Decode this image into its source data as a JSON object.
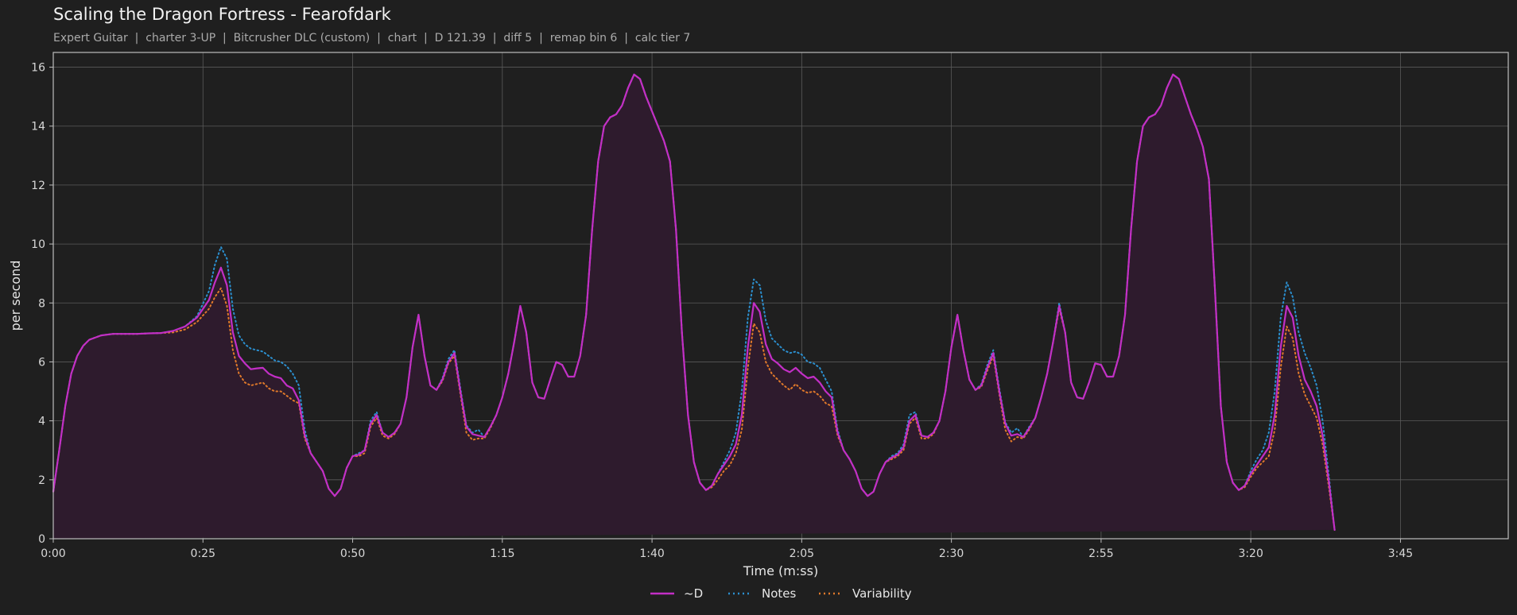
{
  "header": {
    "title": "Scaling the Dragon Fortress - Fearofdark",
    "subtitle": "Expert Guitar  |  charter 3-UP  |  Bitcrusher DLC (custom)  |  chart  |  D 121.39  |  diff 5  |  remap bin 6  |  calc tier 7"
  },
  "colors": {
    "background": "#1f1f1f",
    "grid": "#5a5a5a",
    "axes": "#bdbdbd",
    "fill": "#2e1b2d"
  },
  "chart_data": {
    "type": "line",
    "xlabel": "Time (m:ss)",
    "ylabel": "per second",
    "xlim": [
      0,
      243
    ],
    "ylim": [
      0,
      16.5
    ],
    "grid": true,
    "legend_position": "bottom-center",
    "x_ticks": [
      {
        "value": 0,
        "label": "0:00"
      },
      {
        "value": 25,
        "label": "0:25"
      },
      {
        "value": 50,
        "label": "0:50"
      },
      {
        "value": 75,
        "label": "1:15"
      },
      {
        "value": 100,
        "label": "1:40"
      },
      {
        "value": 125,
        "label": "2:05"
      },
      {
        "value": 150,
        "label": "2:30"
      },
      {
        "value": 175,
        "label": "2:55"
      },
      {
        "value": 200,
        "label": "3:20"
      },
      {
        "value": 225,
        "label": "3:45"
      }
    ],
    "y_ticks": [
      {
        "value": 0,
        "label": "0"
      },
      {
        "value": 2,
        "label": "2"
      },
      {
        "value": 4,
        "label": "4"
      },
      {
        "value": 6,
        "label": "6"
      },
      {
        "value": 8,
        "label": "8"
      },
      {
        "value": 10,
        "label": "10"
      },
      {
        "value": 12,
        "label": "12"
      },
      {
        "value": 14,
        "label": "14"
      },
      {
        "value": 16,
        "label": "16"
      }
    ],
    "x": [
      0,
      1,
      2,
      3,
      4,
      5,
      6,
      8,
      10,
      12,
      14,
      16,
      18,
      20,
      22,
      24,
      26,
      27,
      28,
      29,
      30,
      31,
      32,
      33,
      34,
      35,
      36,
      37,
      38,
      39,
      40,
      41,
      42,
      43,
      44,
      45,
      46,
      47,
      48,
      49,
      50,
      51,
      52,
      53,
      54,
      55,
      56,
      57,
      58,
      59,
      60,
      61,
      62,
      63,
      64,
      65,
      66,
      67,
      68,
      69,
      70,
      71,
      72,
      73,
      74,
      75,
      76,
      77,
      78,
      79,
      80,
      81,
      82,
      83,
      84,
      85,
      86,
      87,
      88,
      89,
      90,
      91,
      92,
      93,
      94,
      95,
      96,
      97,
      98,
      99,
      100,
      101,
      102,
      103,
      104,
      105,
      106,
      107,
      108,
      109,
      110,
      111,
      112,
      113,
      114,
      115,
      116,
      117,
      118,
      119,
      120,
      121,
      122,
      123,
      124,
      125,
      126,
      127,
      128,
      129,
      130,
      131,
      132,
      133,
      134,
      135,
      136,
      137,
      138,
      139,
      140,
      141,
      142,
      143,
      144,
      145,
      146,
      147,
      148,
      149,
      150,
      151,
      152,
      153,
      154,
      155,
      156,
      157,
      158,
      159,
      160,
      161,
      162,
      163,
      164,
      165,
      166,
      167,
      168,
      169,
      170,
      171,
      172,
      173,
      174,
      175,
      176,
      177,
      178,
      179,
      180,
      181,
      182,
      183,
      184,
      185,
      186,
      187,
      188,
      189,
      190,
      191,
      192,
      193,
      194,
      195,
      196,
      197,
      198,
      199,
      200,
      201,
      202,
      203,
      204,
      205,
      206,
      207,
      208,
      209,
      210,
      211,
      212,
      213,
      214,
      215,
      216,
      217,
      218,
      219,
      220,
      221,
      222,
      223,
      224,
      225,
      226,
      227,
      228,
      229,
      230,
      231,
      232,
      233,
      234,
      235,
      236,
      237,
      238,
      239,
      240,
      241,
      242,
      243
    ],
    "series": [
      {
        "name": "~D",
        "color": "#c22fc6",
        "style": "solid",
        "values": [
          1.6,
          3.0,
          4.5,
          5.6,
          6.2,
          6.55,
          6.75,
          6.9,
          6.95,
          6.95,
          6.95,
          6.97,
          6.98,
          7.05,
          7.2,
          7.5,
          8.1,
          8.7,
          9.2,
          8.6,
          7.0,
          6.2,
          5.95,
          5.75,
          5.78,
          5.8,
          5.6,
          5.5,
          5.45,
          5.2,
          5.1,
          4.7,
          3.5,
          2.9,
          2.6,
          2.3,
          1.7,
          1.45,
          1.7,
          2.4,
          2.8,
          2.85,
          3.0,
          3.9,
          4.2,
          3.6,
          3.45,
          3.6,
          3.9,
          4.8,
          6.5,
          7.6,
          6.2,
          5.2,
          5.05,
          5.4,
          6.0,
          6.3,
          5.0,
          3.8,
          3.55,
          3.5,
          3.45,
          3.8,
          4.2,
          4.8,
          5.6,
          6.7,
          7.9,
          7.0,
          5.3,
          4.8,
          4.75,
          5.4,
          6.0,
          5.9,
          5.5,
          5.5,
          6.2,
          7.6,
          10.5,
          12.8,
          14.0,
          14.3,
          14.4,
          14.7,
          15.3,
          15.75,
          15.6,
          15.0,
          14.5,
          14.0,
          13.5,
          12.8,
          10.5,
          7.0,
          4.2,
          2.6,
          1.9,
          1.65,
          1.8,
          2.2,
          2.5,
          2.8,
          3.2,
          4.2,
          6.5,
          8.0,
          7.7,
          6.6,
          6.1,
          5.95,
          5.75,
          5.65,
          5.8,
          5.6,
          5.45,
          5.5,
          5.3,
          5.0,
          4.8,
          3.6,
          3.0,
          2.7,
          2.3,
          1.7,
          1.45,
          1.6,
          2.2,
          2.6,
          2.75,
          2.85,
          3.1,
          4.0,
          4.2,
          3.5,
          3.45,
          3.6,
          4.0,
          5.0,
          6.5,
          7.6,
          6.4,
          5.4,
          5.05,
          5.2,
          5.8,
          6.3,
          5.0,
          3.9,
          3.5,
          3.55,
          3.45,
          3.75,
          4.1,
          4.8,
          5.6,
          6.7,
          7.9,
          7.0,
          5.3,
          4.8,
          4.75,
          5.3,
          5.95,
          5.9,
          5.5,
          5.5,
          6.2,
          7.6,
          10.5,
          12.8,
          14.0,
          14.3,
          14.4,
          14.7,
          15.3,
          15.75,
          15.6,
          15.0,
          14.4,
          13.9,
          13.3,
          12.2,
          8.5,
          4.5,
          2.6,
          1.9,
          1.65,
          1.8,
          2.2,
          2.5,
          2.8,
          3.1,
          4.2,
          6.5,
          7.9,
          7.5,
          6.2,
          5.4,
          5.0,
          4.5,
          3.5,
          2.0,
          0.3
        ]
      },
      {
        "name": "Notes",
        "color": "#2b8fcf",
        "style": "dotted",
        "values": [
          1.6,
          3.0,
          4.5,
          5.6,
          6.2,
          6.55,
          6.75,
          6.9,
          6.95,
          6.95,
          6.95,
          6.97,
          6.98,
          7.05,
          7.2,
          7.55,
          8.4,
          9.3,
          9.9,
          9.5,
          7.8,
          6.9,
          6.6,
          6.45,
          6.4,
          6.35,
          6.2,
          6.05,
          6.0,
          5.85,
          5.6,
          5.2,
          3.7,
          2.9,
          2.6,
          2.3,
          1.7,
          1.45,
          1.7,
          2.4,
          2.8,
          2.9,
          3.0,
          4.0,
          4.3,
          3.6,
          3.45,
          3.6,
          3.9,
          4.8,
          6.5,
          7.6,
          6.2,
          5.2,
          5.05,
          5.45,
          6.1,
          6.4,
          5.1,
          3.85,
          3.6,
          3.7,
          3.45,
          3.8,
          4.2,
          4.8,
          5.6,
          6.7,
          7.9,
          7.0,
          5.3,
          4.8,
          4.75,
          5.4,
          6.0,
          5.9,
          5.5,
          5.5,
          6.2,
          7.6,
          10.5,
          12.8,
          14.0,
          14.3,
          14.4,
          14.7,
          15.3,
          15.75,
          15.6,
          15.0,
          14.5,
          14.0,
          13.5,
          12.8,
          10.5,
          7.0,
          4.2,
          2.6,
          1.9,
          1.65,
          1.8,
          2.2,
          2.6,
          3.0,
          3.6,
          5.0,
          7.5,
          8.8,
          8.6,
          7.4,
          6.8,
          6.6,
          6.4,
          6.3,
          6.35,
          6.25,
          6.0,
          5.95,
          5.8,
          5.4,
          5.0,
          3.7,
          3.0,
          2.7,
          2.3,
          1.7,
          1.45,
          1.6,
          2.2,
          2.6,
          2.8,
          2.9,
          3.2,
          4.2,
          4.3,
          3.5,
          3.45,
          3.6,
          4.0,
          5.0,
          6.5,
          7.6,
          6.4,
          5.4,
          5.05,
          5.25,
          5.9,
          6.4,
          5.1,
          3.95,
          3.6,
          3.75,
          3.45,
          3.8,
          4.1,
          4.8,
          5.6,
          6.7,
          8.0,
          7.0,
          5.3,
          4.8,
          4.75,
          5.3,
          5.95,
          5.9,
          5.5,
          5.5,
          6.2,
          7.6,
          10.5,
          12.8,
          14.0,
          14.3,
          14.4,
          14.7,
          15.3,
          15.75,
          15.6,
          15.0,
          14.4,
          13.9,
          13.3,
          12.2,
          8.5,
          4.5,
          2.6,
          1.9,
          1.65,
          1.8,
          2.3,
          2.7,
          3.0,
          3.6,
          5.0,
          7.5,
          8.7,
          8.2,
          7.0,
          6.3,
          5.8,
          5.2,
          4.0,
          2.2,
          0.3
        ]
      },
      {
        "name": "Variability",
        "color": "#e0792a",
        "style": "dotted",
        "values": [
          1.6,
          3.0,
          4.5,
          5.6,
          6.2,
          6.55,
          6.75,
          6.9,
          6.95,
          6.95,
          6.95,
          6.97,
          6.98,
          7.0,
          7.1,
          7.35,
          7.8,
          8.2,
          8.5,
          7.9,
          6.4,
          5.6,
          5.3,
          5.2,
          5.25,
          5.3,
          5.1,
          5.0,
          5.0,
          4.85,
          4.7,
          4.6,
          3.4,
          2.9,
          2.6,
          2.3,
          1.7,
          1.45,
          1.7,
          2.4,
          2.8,
          2.8,
          2.9,
          3.8,
          4.1,
          3.5,
          3.4,
          3.55,
          3.9,
          4.8,
          6.5,
          7.6,
          6.2,
          5.2,
          5.05,
          5.35,
          5.95,
          6.2,
          4.9,
          3.6,
          3.35,
          3.4,
          3.4,
          3.75,
          4.2,
          4.8,
          5.6,
          6.7,
          7.9,
          7.0,
          5.3,
          4.8,
          4.75,
          5.4,
          6.0,
          5.9,
          5.5,
          5.5,
          6.2,
          7.6,
          10.5,
          12.8,
          14.0,
          14.3,
          14.4,
          14.7,
          15.3,
          15.75,
          15.6,
          15.0,
          14.5,
          14.0,
          13.5,
          12.8,
          10.5,
          7.0,
          4.2,
          2.6,
          1.9,
          1.65,
          1.75,
          2.0,
          2.3,
          2.5,
          2.9,
          3.7,
          5.8,
          7.3,
          7.0,
          6.0,
          5.6,
          5.4,
          5.2,
          5.05,
          5.25,
          5.05,
          4.95,
          5.0,
          4.85,
          4.6,
          4.5,
          3.5,
          3.0,
          2.7,
          2.3,
          1.7,
          1.45,
          1.6,
          2.2,
          2.6,
          2.7,
          2.8,
          3.0,
          3.9,
          4.1,
          3.4,
          3.4,
          3.55,
          4.0,
          5.0,
          6.5,
          7.6,
          6.4,
          5.4,
          5.05,
          5.15,
          5.7,
          6.2,
          4.9,
          3.7,
          3.3,
          3.45,
          3.4,
          3.7,
          4.1,
          4.8,
          5.6,
          6.7,
          7.8,
          7.0,
          5.3,
          4.8,
          4.75,
          5.3,
          5.95,
          5.9,
          5.5,
          5.5,
          6.2,
          7.6,
          10.5,
          12.8,
          14.0,
          14.3,
          14.4,
          14.7,
          15.3,
          15.75,
          15.6,
          15.0,
          14.4,
          13.9,
          13.3,
          12.2,
          8.5,
          4.5,
          2.6,
          1.9,
          1.65,
          1.75,
          2.1,
          2.4,
          2.6,
          2.8,
          3.7,
          5.8,
          7.2,
          6.8,
          5.6,
          4.9,
          4.5,
          4.1,
          3.2,
          1.8,
          0.3
        ]
      }
    ]
  }
}
